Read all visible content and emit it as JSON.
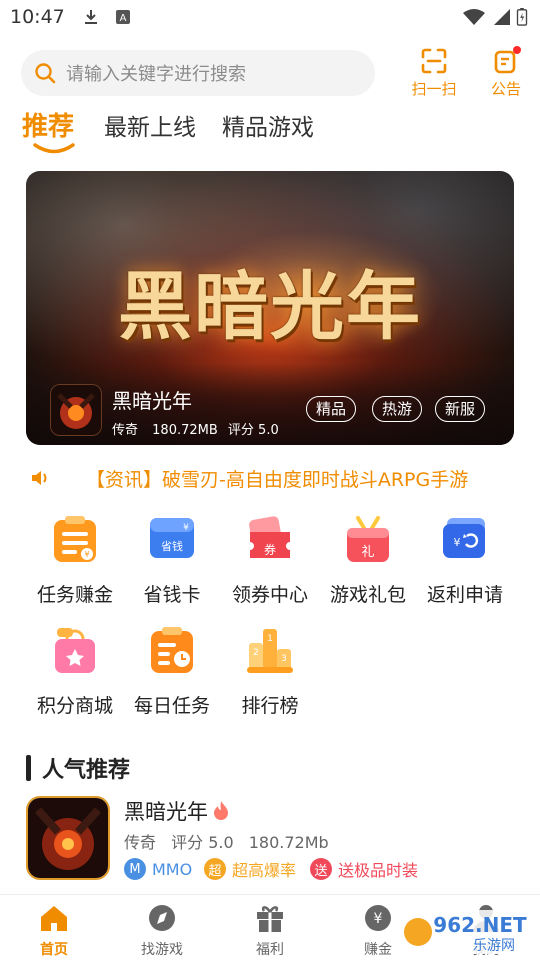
{
  "status_bar": {
    "time": "10:47"
  },
  "search": {
    "placeholder": "请输入关键字进行搜索"
  },
  "header_buttons": {
    "scan_label": "扫一扫",
    "notice_label": "公告"
  },
  "tabs": [
    {
      "label": "推荐",
      "active": true
    },
    {
      "label": "最新上线",
      "active": false
    },
    {
      "label": "精品游戏",
      "active": false
    }
  ],
  "banner": {
    "title_art": "黑暗光年",
    "game_name": "黑暗光年",
    "genre": "传奇",
    "size": "180.72MB",
    "rating": "评分 5.0",
    "tags": [
      "精品",
      "热游",
      "新服"
    ]
  },
  "news": {
    "text": "【资讯】破雪刃-高自由度即时战斗ARPG手游"
  },
  "features": [
    {
      "label": "任务赚金"
    },
    {
      "label": "省钱卡"
    },
    {
      "label": "领券中心"
    },
    {
      "label": "游戏礼包"
    },
    {
      "label": "返利申请"
    },
    {
      "label": "积分商城"
    },
    {
      "label": "每日任务"
    },
    {
      "label": "排行榜"
    }
  ],
  "section": {
    "title": "人气推荐"
  },
  "popular_app": {
    "name": "黑暗光年",
    "genre": "传奇",
    "rating": "评分 5.0",
    "size": "180.72Mb",
    "tags": [
      {
        "badge": "M",
        "text": "MMO",
        "color": "#4a90e2"
      },
      {
        "badge": "超",
        "text": "超高爆率",
        "color": "#f5a623"
      },
      {
        "badge": "送",
        "text": "送极品时装",
        "color": "#f04a5a"
      }
    ]
  },
  "bottom_nav": [
    {
      "label": "首页",
      "icon": "home-icon",
      "active": true
    },
    {
      "label": "找游戏",
      "icon": "compass-icon",
      "active": false
    },
    {
      "label": "福利",
      "icon": "gift-icon",
      "active": false
    },
    {
      "label": "赚金",
      "icon": "coin-icon",
      "active": false
    },
    {
      "label": "我的",
      "icon": "user-icon",
      "active": false
    }
  ],
  "watermark": {
    "brand": "962.NET",
    "sub": "乐游网"
  },
  "colors": {
    "accent": "#f08c00",
    "badge_red": "#ff2a2a"
  }
}
